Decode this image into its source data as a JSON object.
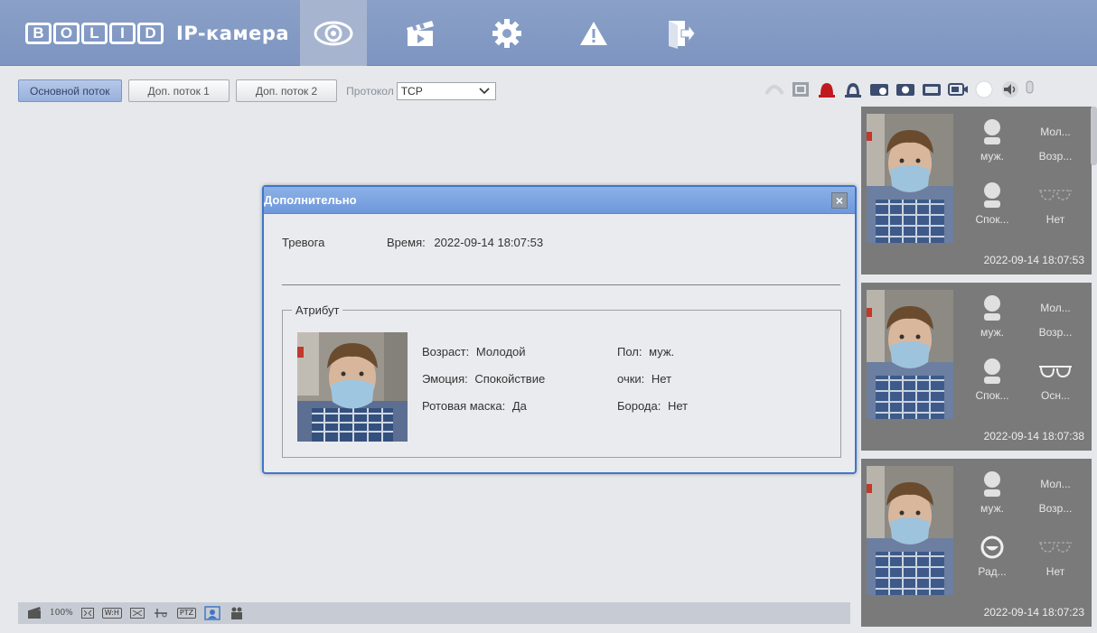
{
  "header": {
    "logo_letters": [
      "B",
      "O",
      "L",
      "I",
      "D"
    ],
    "logo_title": "IP-камера",
    "nav": [
      {
        "icon": "eye-icon",
        "active": true
      },
      {
        "icon": "clapperboard-icon",
        "active": false
      },
      {
        "icon": "gear-icon",
        "active": false
      },
      {
        "icon": "warning-icon",
        "active": false
      },
      {
        "icon": "logout-icon",
        "active": false
      }
    ]
  },
  "stream_bar": {
    "main_stream": "Основной поток",
    "sub_stream_1": "Доп. поток 1",
    "sub_stream_2": "Доп. поток 2",
    "protocol_label": "Протокол",
    "protocol_value": "TCP"
  },
  "bottom_bar": {
    "zoom_label": "100%",
    "wh_label": "W:H",
    "ptz_label": "PTZ"
  },
  "dialog": {
    "title": "Дополнительно",
    "alarm_label": "Тревога",
    "time_label": "Время:",
    "time_value": "2022-09-14 18:07:53",
    "attribute_legend": "Атрибут",
    "age_label": "Возраст:",
    "age_value": "Молодой",
    "gender_label": "Пол:",
    "gender_value": "муж.",
    "emotion_label": "Эмоция:",
    "emotion_value": "Спокойствие",
    "glasses_label": "очки:",
    "glasses_value": "Нет",
    "mask_label": "Ротовая маска:",
    "mask_value": "Да",
    "beard_label": "Борода:",
    "beard_value": "Нет"
  },
  "cards": [
    {
      "age": "Мол...",
      "gender": "муж.",
      "age_label": "Возр...",
      "emotion": "Спок...",
      "glasses": "Нет",
      "timestamp": "2022-09-14 18:07:53"
    },
    {
      "age": "Мол...",
      "gender": "муж.",
      "age_label": "Возр...",
      "emotion": "Спок...",
      "glasses": "Осн...",
      "timestamp": "2022-09-14 18:07:38"
    },
    {
      "age": "Мол...",
      "gender": "муж.",
      "age_label": "Возр...",
      "emotion": "Рад...",
      "glasses": "Нет",
      "timestamp": "2022-09-14 18:07:23"
    }
  ],
  "colors": {
    "header_bg": "#8aa0c8",
    "dialog_border": "#3f76c7",
    "card_bg": "#7a7a7a"
  }
}
